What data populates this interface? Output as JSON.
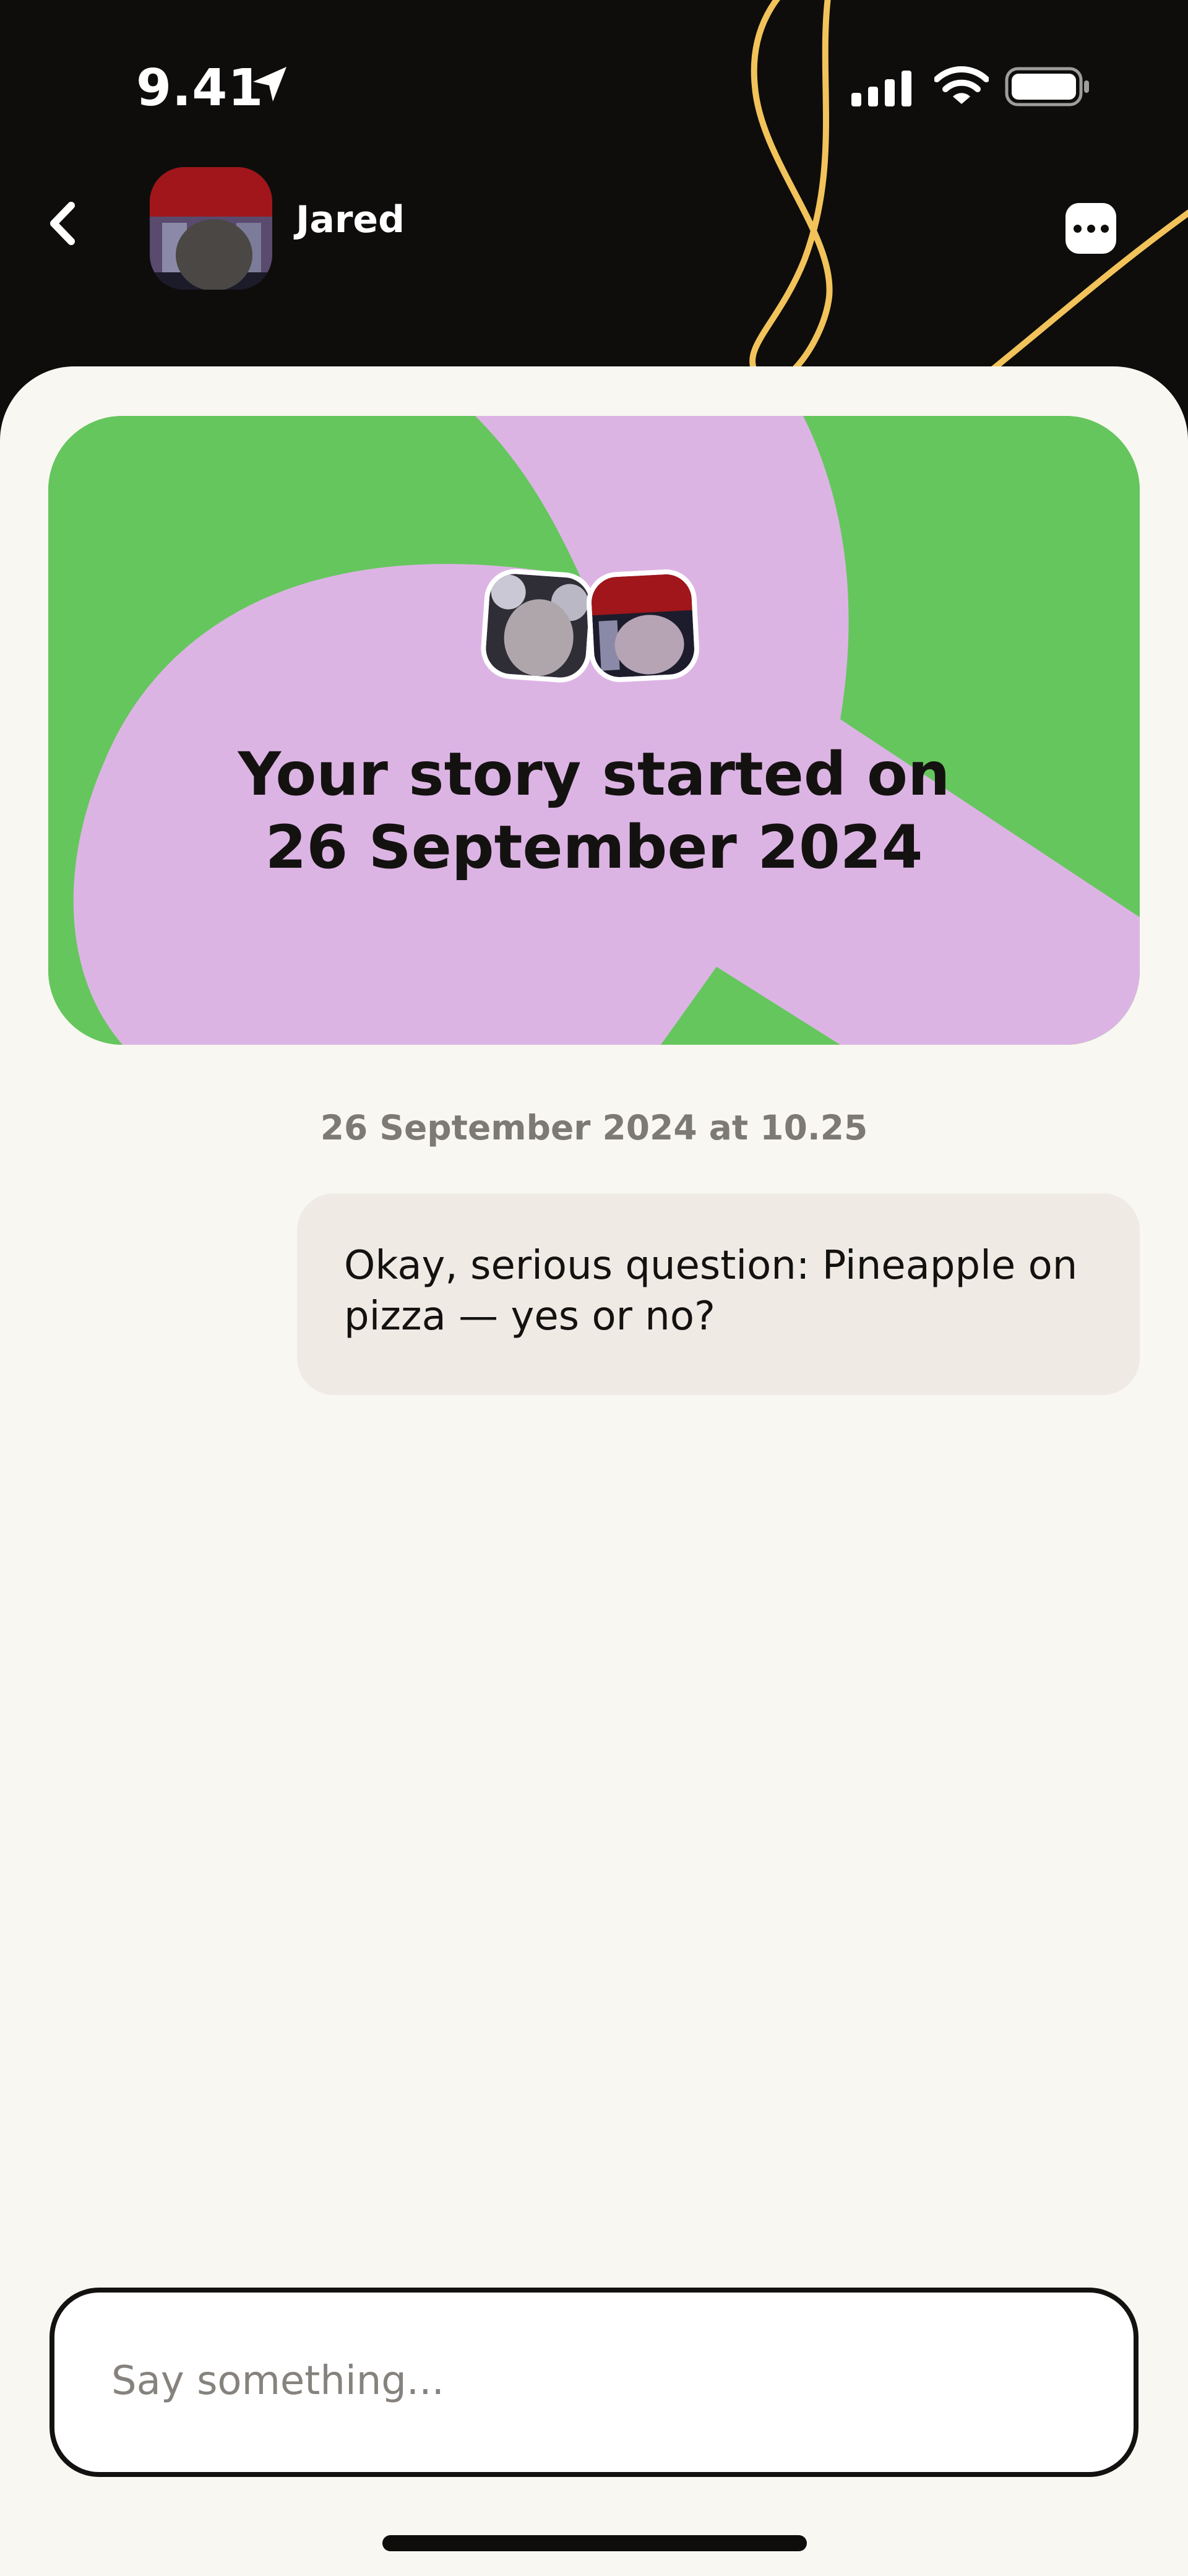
{
  "status_bar": {
    "time": "9.41",
    "location_icon": "location-arrow-icon",
    "signal_icon": "cellular-signal-icon",
    "wifi_icon": "wifi-icon",
    "battery_icon": "battery-icon"
  },
  "header": {
    "back_icon": "chevron-left-icon",
    "contact_name": "Jared",
    "more_icon": "more-dots-icon"
  },
  "story_card": {
    "title_line1": "Your story started on",
    "title_line2": "26 September 2024"
  },
  "conversation": {
    "timestamp": "26 September 2024 at 10.25",
    "messages": [
      {
        "text": "Okay, serious question: Pineapple on pizza — yes or no?"
      }
    ]
  },
  "composer": {
    "placeholder": "Say something...",
    "value": ""
  },
  "colors": {
    "dark": "#0e0d0b",
    "sheet": "#f9f7f1",
    "card_green": "#65c65d",
    "card_pink": "#dcb4e4",
    "accent_yellow": "#f2c35a",
    "bubble": "#efebe4"
  }
}
